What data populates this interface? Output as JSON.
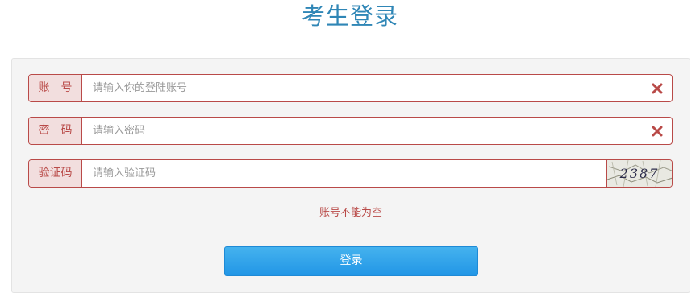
{
  "page_title": "考生登录",
  "fields": {
    "account": {
      "label": "账　号",
      "placeholder": "请输入你的登陆账号",
      "value": "",
      "clear_icon": "close-x-icon"
    },
    "password": {
      "label": "密　码",
      "placeholder": "请输入密码",
      "value": "",
      "clear_icon": "close-x-icon"
    },
    "captcha": {
      "label": "验证码",
      "placeholder": "请输入验证码",
      "value": "",
      "image_text": "2387"
    }
  },
  "error_message": "账号不能为空",
  "login_button": "登录",
  "colors": {
    "title": "#2f86b6",
    "error": "#b94a48",
    "error_bg": "#f2dede",
    "button": "#2296e6"
  }
}
